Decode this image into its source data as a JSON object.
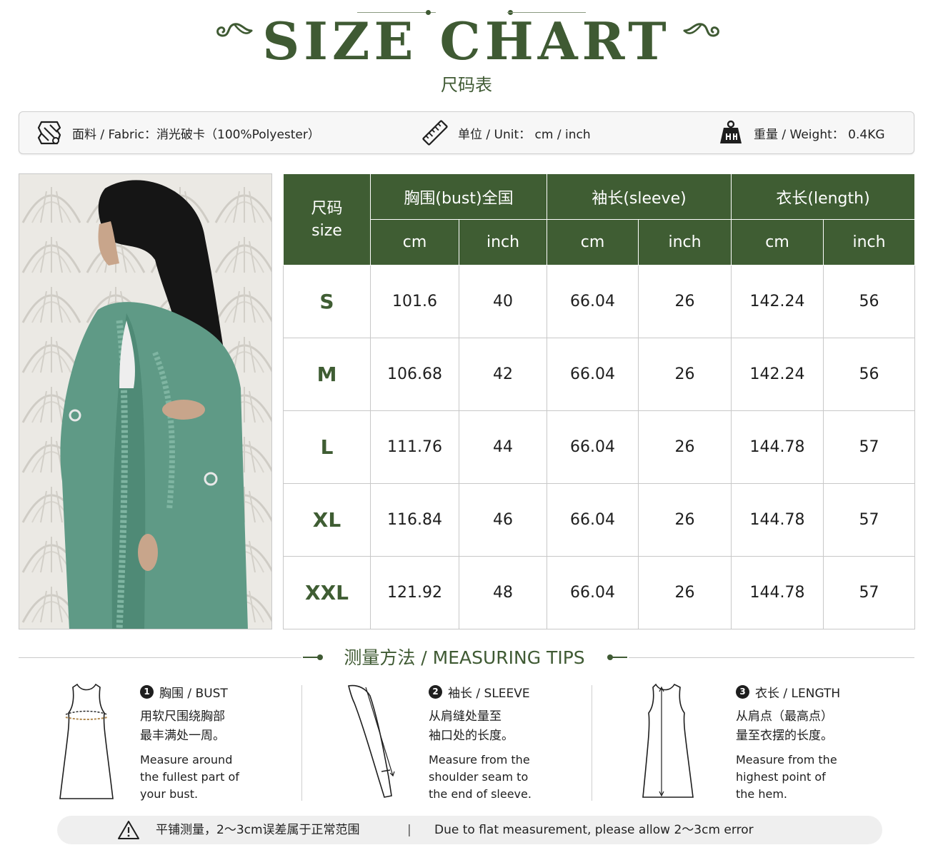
{
  "header": {
    "title": "SIZE CHART",
    "subtitle": "尺码表"
  },
  "info_bar": {
    "fabric": "面料 / Fabric：消光破卡（100%Polyester）",
    "unit": "单位 / Unit：  cm / inch",
    "weight": "重量 / Weight：   0.4KG"
  },
  "table": {
    "corner_cn": "尺码",
    "corner_en": "size",
    "groups": [
      "胸围(bust)全国",
      "袖长(sleeve)",
      "衣长(length)"
    ],
    "units": [
      "cm",
      "inch",
      "cm",
      "inch",
      "cm",
      "inch"
    ],
    "rows": [
      {
        "size": "S",
        "cells": [
          "101.6",
          "40",
          "66.04",
          "26",
          "142.24",
          "56"
        ]
      },
      {
        "size": "M",
        "cells": [
          "106.68",
          "42",
          "66.04",
          "26",
          "142.24",
          "56"
        ]
      },
      {
        "size": "L",
        "cells": [
          "111.76",
          "44",
          "66.04",
          "26",
          "144.78",
          "57"
        ]
      },
      {
        "size": "XL",
        "cells": [
          "116.84",
          "46",
          "66.04",
          "26",
          "144.78",
          "57"
        ]
      },
      {
        "size": "XXL",
        "cells": [
          "121.92",
          "48",
          "66.04",
          "26",
          "144.78",
          "57"
        ]
      }
    ]
  },
  "tips": {
    "heading": "测量方法 / MEASURING TIPS",
    "items": [
      {
        "num": "1",
        "title": "胸围 / BUST",
        "cn": "用软尺围绕胸部\n最丰满处一周。",
        "en": "Measure around\nthe fullest part of\nyour bust."
      },
      {
        "num": "2",
        "title": "袖长 / SLEEVE",
        "cn": "从肩缝处量至\n袖口处的长度。",
        "en": "Measure from the\nshoulder seam to\nthe end of sleeve."
      },
      {
        "num": "3",
        "title": "衣长 / LENGTH",
        "cn": "从肩点（最高点）\n量至衣摆的长度。",
        "en": "Measure from the\nhighest point of\nthe hem."
      }
    ]
  },
  "note": {
    "cn": "平铺测量，2～3cm误差属于正常范围",
    "separator": "|",
    "en": "Due to flat measurement, please allow 2～3cm error"
  },
  "colors": {
    "accent": "#3f5d33",
    "header_text": "#3f5a33",
    "robe": "#5f9a86"
  },
  "icons": [
    "swirl-ornament-icon",
    "fabric-icon",
    "ruler-icon",
    "weight-icon",
    "warning-icon"
  ]
}
